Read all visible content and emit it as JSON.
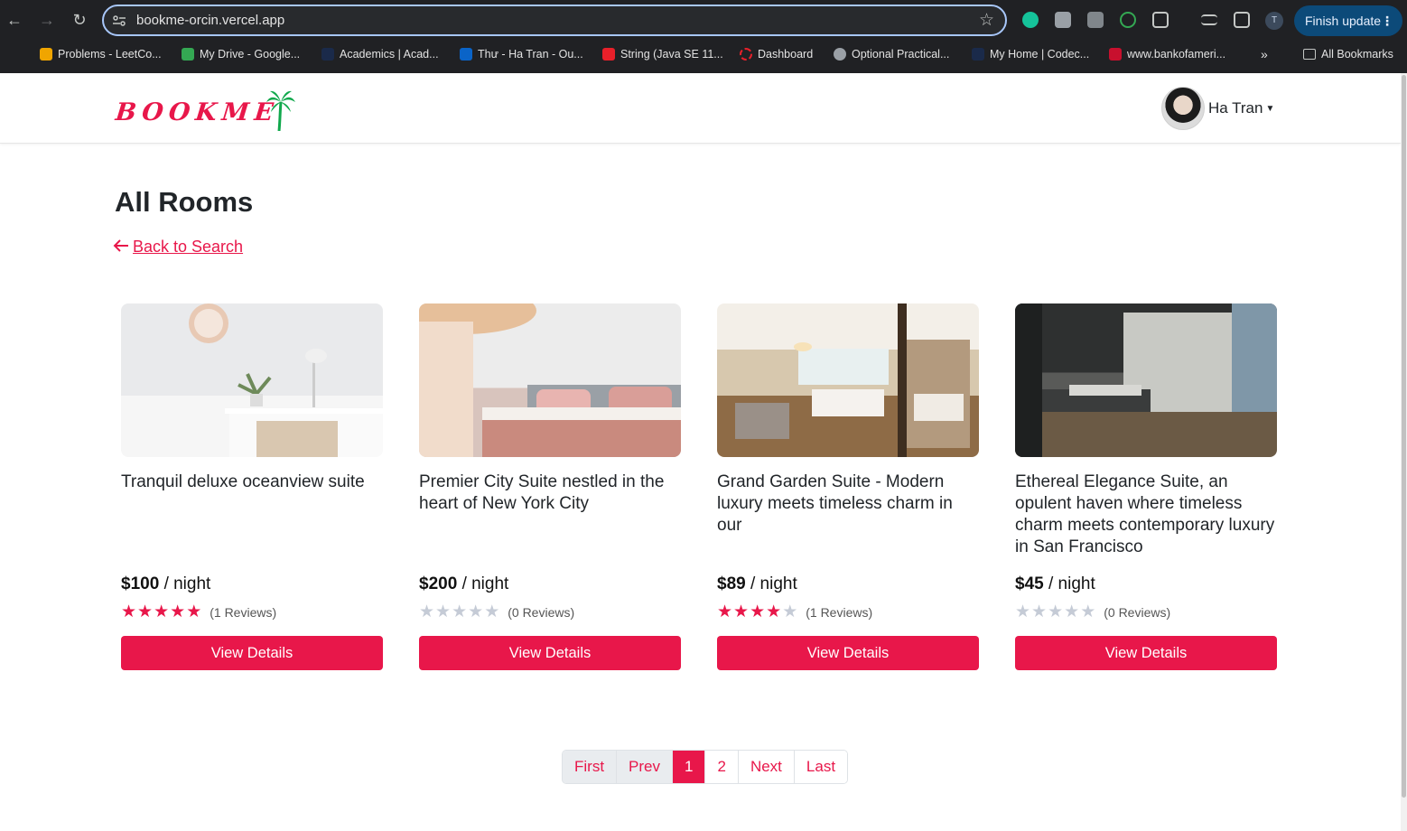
{
  "browser": {
    "url": "bookme-orcin.vercel.app",
    "finish_update": "Finish update",
    "profile_initial": "T",
    "bookmarks": [
      {
        "label": "Problems - LeetCo...",
        "color": "#f0a500"
      },
      {
        "label": "My Drive - Google...",
        "color": "#34a853"
      },
      {
        "label": "Academics | Acad...",
        "color": "#1a2a4a"
      },
      {
        "label": "Thư - Ha Tran - Ou...",
        "color": "#0a64c8"
      },
      {
        "label": "String (Java SE 11...",
        "color": "#e8202a"
      },
      {
        "label": "Dashboard",
        "color": "#e8202a"
      },
      {
        "label": "Optional Practical...",
        "color": "#9aa0a6"
      },
      {
        "label": "My Home | Codec...",
        "color": "#1a2a4a"
      },
      {
        "label": "www.bankofameri...",
        "color": "#c8102e"
      }
    ],
    "all_bookmarks": "All Bookmarks"
  },
  "site": {
    "logo_text": "BOOKME",
    "user_name": "Ha Tran"
  },
  "page": {
    "title": "All Rooms",
    "back_link": "Back to Search"
  },
  "rooms": [
    {
      "title": "Tranquil deluxe oceanview suite",
      "price": "$100",
      "unit": "/ night",
      "rating": 5,
      "reviews": "(1 Reviews)",
      "button": "View Details"
    },
    {
      "title": "Premier City Suite nestled in the heart of New York City",
      "price": "$200",
      "unit": "/ night",
      "rating": 0,
      "reviews": "(0 Reviews)",
      "button": "View Details"
    },
    {
      "title": "Grand Garden Suite - Modern luxury meets timeless charm in our",
      "price": "$89",
      "unit": "/ night",
      "rating": 4,
      "reviews": "(1 Reviews)",
      "button": "View Details"
    },
    {
      "title": "Ethereal Elegance Suite, an opulent haven where timeless charm meets contemporary luxury in San Francisco",
      "price": "$45",
      "unit": "/ night",
      "rating": 0,
      "reviews": "(0 Reviews)",
      "button": "View Details"
    }
  ],
  "pagination": {
    "first": "First",
    "prev": "Prev",
    "pages": [
      "1",
      "2"
    ],
    "current": "1",
    "next": "Next",
    "last": "Last"
  },
  "colors": {
    "accent": "#e8174a",
    "star_inactive": "#c5cbd6"
  }
}
